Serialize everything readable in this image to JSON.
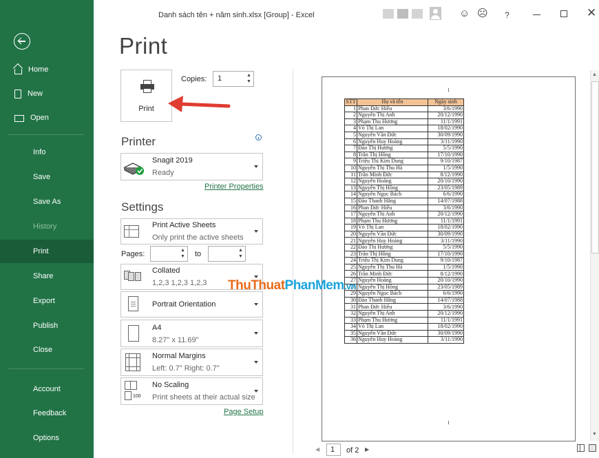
{
  "window": {
    "title": "Danh sách tên + năm sinh.xlsx  [Group]  -  Excel",
    "smile_glyph": "☺",
    "frown_glyph": "☹",
    "help_glyph": "?",
    "close_glyph": "✕"
  },
  "sidebar": {
    "bg_color": "#217346",
    "items": [
      {
        "label": "Home"
      },
      {
        "label": "New"
      },
      {
        "label": "Open"
      },
      {
        "label": "Info"
      },
      {
        "label": "Save"
      },
      {
        "label": "Save As"
      },
      {
        "label": "History"
      },
      {
        "label": "Print"
      },
      {
        "label": "Share"
      },
      {
        "label": "Export"
      },
      {
        "label": "Publish"
      },
      {
        "label": "Close"
      },
      {
        "label": "Account"
      },
      {
        "label": "Feedback"
      },
      {
        "label": "Options"
      }
    ],
    "active": "Print"
  },
  "print": {
    "title": "Print",
    "button_label": "Print",
    "copies_label": "Copies:",
    "copies_value": "1"
  },
  "printer": {
    "heading": "Printer",
    "name": "Snagit 2019",
    "status": "Ready",
    "properties_link": "Printer Properties"
  },
  "settings": {
    "heading": "Settings",
    "sheets_title": "Print Active Sheets",
    "sheets_sub": "Only print the active sheets",
    "pages_label": "Pages:",
    "pages_to": "to",
    "collated_title": "Collated",
    "collated_sub": "1,2,3    1,2,3    1,2,3",
    "orientation_title": "Portrait Orientation",
    "paper_title": "A4",
    "paper_sub": "8.27\" x 11.69\"",
    "margins_title": "Normal Margins",
    "margins_sub": "Left:  0.7\"    Right:  0.7\"",
    "scaling_title": "No Scaling",
    "scaling_sub": "Print sheets at their actual size",
    "scaling_icon_text": "100",
    "page_setup_link": "Page Setup"
  },
  "preview": {
    "page_number_top": "1",
    "page_number_bottom": "1",
    "headers": [
      "STT",
      "Họ và tên",
      "Ngày sinh"
    ],
    "rows": [
      [
        "1",
        "Phan Đức Hiếu",
        "3/6/1990"
      ],
      [
        "2",
        "Nguyễn Thị Anh",
        "20/12/1990"
      ],
      [
        "3",
        "Phạm Thu Hương",
        "11/1/1991"
      ],
      [
        "4",
        "Võ Thị Lan",
        "18/02/1990"
      ],
      [
        "5",
        "Nguyễn Văn Đức",
        "30/09/1990"
      ],
      [
        "6",
        "Nguyễn Huy Hoàng",
        "3/11/1990"
      ],
      [
        "7",
        "Đào Thị Hương",
        "5/5/1990"
      ],
      [
        "8",
        "Trần Thị Hồng",
        "17/10/1990"
      ],
      [
        "9",
        "Triệu Thị Kim Dung",
        "9/10/1987"
      ],
      [
        "10",
        "Nguyễn Thị Thu Hà",
        "1/5/1990"
      ],
      [
        "11",
        "Trần Minh Đức",
        "8/12/1990"
      ],
      [
        "12",
        "Nguyễn Hoàng",
        "20/10/1990"
      ],
      [
        "13",
        "Nguyễn Thị Hồng",
        "23/05/1989"
      ],
      [
        "14",
        "Nguyễn Ngọc Bách",
        "6/6/1990"
      ],
      [
        "15",
        "Đào Thanh Hằng",
        "14/07/1988"
      ],
      [
        "16",
        "Phan Đức Hiếu",
        "3/6/1990"
      ],
      [
        "17",
        "Nguyễn Thị Anh",
        "20/12/1990"
      ],
      [
        "18",
        "Phạm Thu Hương",
        "11/1/1991"
      ],
      [
        "19",
        "Võ Thị Lan",
        "18/02/1990"
      ],
      [
        "20",
        "Nguyễn Văn Đức",
        "30/09/1990"
      ],
      [
        "21",
        "Nguyễn Huy Hoàng",
        "3/11/1990"
      ],
      [
        "22",
        "Đào Thị Hương",
        "5/5/1990"
      ],
      [
        "23",
        "Trần Thị Hồng",
        "17/10/1990"
      ],
      [
        "24",
        "Triệu Thị Kim Dung",
        "9/10/1987"
      ],
      [
        "25",
        "Nguyễn Thị Thu Hà",
        "1/5/1990"
      ],
      [
        "26",
        "Trần Minh Đức",
        "8/12/1990"
      ],
      [
        "27",
        "Nguyễn Hoàng",
        "20/10/1990"
      ],
      [
        "28",
        "Nguyễn Thị Hồng",
        "23/05/1989"
      ],
      [
        "29",
        "Nguyễn Ngọc Bách",
        "6/6/1990"
      ],
      [
        "30",
        "Đào Thanh Hằng",
        "14/07/1988"
      ],
      [
        "31",
        "Phan Đức Hiếu",
        "3/6/1990"
      ],
      [
        "32",
        "Nguyễn Thị Anh",
        "20/12/1990"
      ],
      [
        "33",
        "Phạm Thu Hương",
        "11/1/1991"
      ],
      [
        "34",
        "Võ Thị Lan",
        "18/02/1990"
      ],
      [
        "35",
        "Nguyễn Văn Đức",
        "30/09/1990"
      ],
      [
        "36",
        "Nguyễn Huy Hoàng",
        "3/11/1990"
      ]
    ],
    "current_page": "1",
    "of_pages": "of 2"
  },
  "watermark": {
    "part1": "ThuThuat",
    "part2": "PhanMem",
    "part3": ".vn",
    "color1": "#e86c1b",
    "color2": "#1aa3dd"
  },
  "icons": {
    "back": "back-arrow-icon",
    "home": "home-icon",
    "new": "new-document-icon",
    "open": "open-folder-icon",
    "printer": "printer-icon",
    "spin_up": "▲",
    "spin_down": "▼",
    "prev": "◀",
    "next": "▶"
  }
}
